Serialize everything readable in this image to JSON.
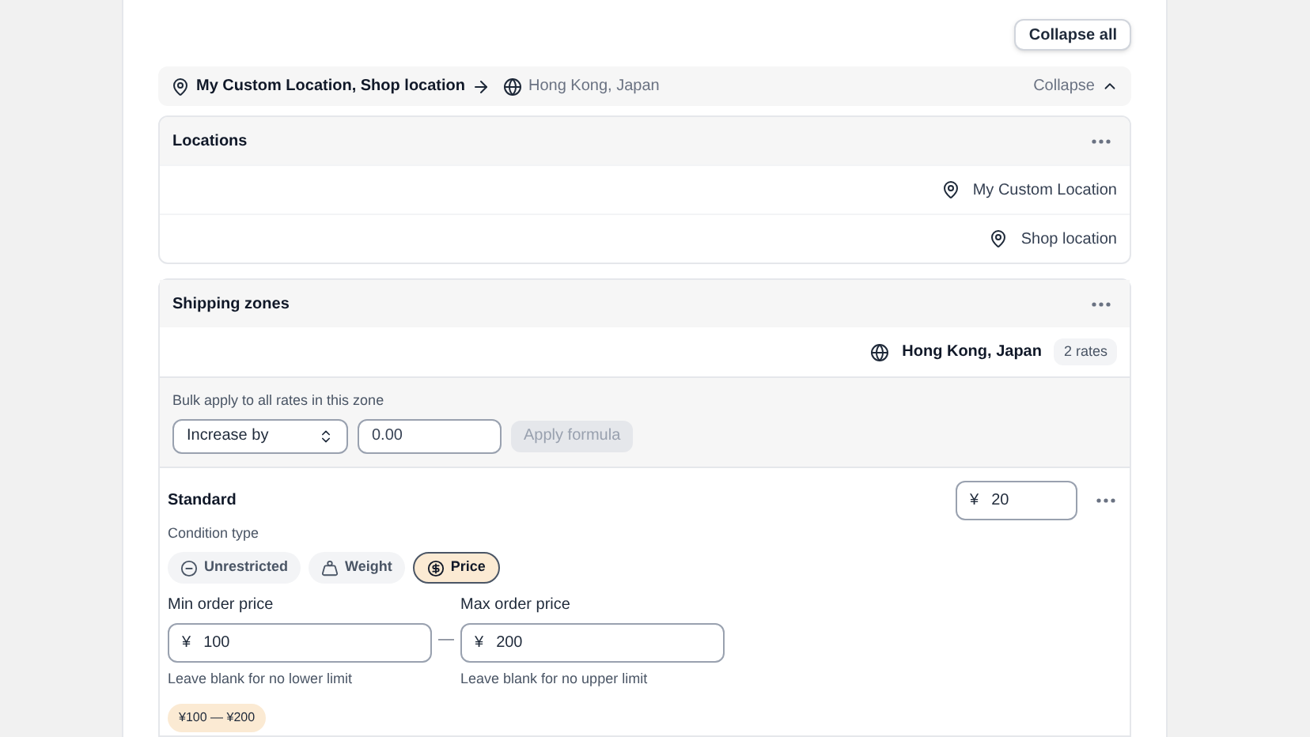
{
  "collapse_all_button": "Collapse all",
  "route": {
    "origins": "My Custom Location, Shop location",
    "destination": "Hong Kong, Japan",
    "toggle": "Collapse",
    "expanded": true
  },
  "locations": {
    "title": "Locations",
    "items": [
      "My Custom Location",
      "Shop location"
    ]
  },
  "shipping_zones": {
    "title": "Shipping zones",
    "zone": "Hong Kong, Japan",
    "rate_count": "2 rates",
    "bulk": {
      "label": "Bulk apply to all rates in this zone",
      "select": "Increase by",
      "amount_placeholder": "0.00",
      "apply_button": "Apply formula",
      "apply_disabled": true
    },
    "rate": {
      "name": "Standard",
      "currency": "¥",
      "price": "20",
      "condition_label": "Condition type",
      "conditions": [
        {
          "kind": "unrestricted",
          "label": "Unrestricted",
          "selected": false
        },
        {
          "kind": "weight",
          "label": "Weight",
          "selected": false
        },
        {
          "kind": "price",
          "label": "Price",
          "selected": true
        }
      ],
      "min": {
        "label": "Min order price",
        "currency": "¥",
        "value": "100",
        "help": "Leave blank for no lower limit"
      },
      "separator": "—",
      "max": {
        "label": "Max order price",
        "currency": "¥",
        "value": "200",
        "help": "Leave blank for no upper limit"
      },
      "summary": "¥100 — ¥200"
    }
  }
}
